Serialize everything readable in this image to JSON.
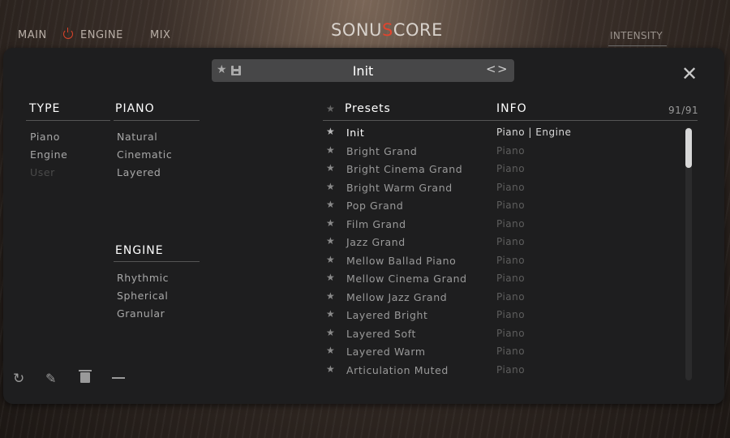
{
  "nav": {
    "main": "MAIN",
    "engine": "ENGINE",
    "mix": "MIX",
    "logo_a": "SONU",
    "logo_b": "S",
    "logo_c": "CORE",
    "intensity": "INTENSITY"
  },
  "preset_bar": {
    "star_icon": "★",
    "current": "Init",
    "prev_icon": "<",
    "next_icon": ">"
  },
  "close_icon": "✕",
  "type_column": {
    "header": "TYPE",
    "items": [
      "Piano",
      "Engine",
      "User"
    ]
  },
  "piano_column": {
    "header": "PIANO",
    "items": [
      "Natural",
      "Cinematic",
      "Layered"
    ]
  },
  "engine_column": {
    "header": "ENGINE",
    "items": [
      "Rhythmic",
      "Spherical",
      "Granular"
    ]
  },
  "presets": {
    "header": "Presets",
    "info_header": "INFO",
    "count": "91/91",
    "star_icon": "★",
    "rows": [
      {
        "name": "Init",
        "info": "Piano |  Engine"
      },
      {
        "name": "Bright Grand",
        "info": "Piano"
      },
      {
        "name": "Bright Cinema Grand",
        "info": "Piano"
      },
      {
        "name": "Bright Warm Grand",
        "info": "Piano"
      },
      {
        "name": "Pop Grand",
        "info": "Piano"
      },
      {
        "name": "Film Grand",
        "info": "Piano"
      },
      {
        "name": "Jazz Grand",
        "info": "Piano"
      },
      {
        "name": "Mellow Ballad Piano",
        "info": "Piano"
      },
      {
        "name": "Mellow Cinema Grand",
        "info": "Piano"
      },
      {
        "name": "Mellow Jazz Grand",
        "info": "Piano"
      },
      {
        "name": "Layered Bright",
        "info": "Piano"
      },
      {
        "name": "Layered Soft",
        "info": "Piano"
      },
      {
        "name": "Layered Warm",
        "info": "Piano"
      },
      {
        "name": "Articulation Muted",
        "info": "Piano"
      }
    ]
  },
  "toolbar": {
    "refresh_icon": "↻",
    "edit_icon": "✎"
  },
  "colors": {
    "accent": "#e0452f",
    "panel": "#1e1e1f",
    "bar": "#474748"
  }
}
